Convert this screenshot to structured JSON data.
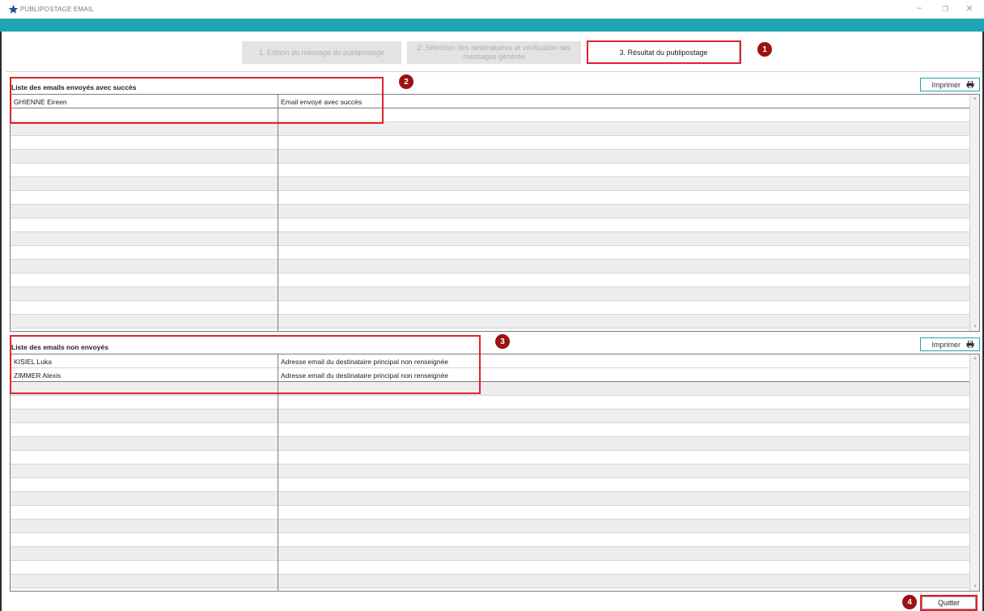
{
  "window": {
    "title": "PUBLIPOSTAGE EMAIL",
    "accent_color": "#1ea5b2",
    "controls": {
      "minimize": "–",
      "restore": "❐",
      "close": "✕"
    }
  },
  "steps": [
    {
      "label": "1. Edition du message du publipostage",
      "state": "disabled"
    },
    {
      "label": "2. Sélection des destinataires et vérification des messages générés",
      "state": "disabled"
    },
    {
      "label": "3. Résultat du publipostage",
      "state": "active"
    }
  ],
  "annotations": [
    "1",
    "2",
    "3",
    "4"
  ],
  "sent": {
    "title": "Liste des emails envoyés avec succès",
    "print_label": "Imprimer",
    "rows": [
      {
        "name": "GHIENNE Eireen",
        "status": "Email envoyé avec succès"
      }
    ]
  },
  "unsent": {
    "title": "Liste des emails non envoyés",
    "print_label": "Imprimer",
    "rows": [
      {
        "name": "KISIEL Luka",
        "status": "Adresse email du destinataire principal non renseignée"
      },
      {
        "name": "ZIMMER Alexis",
        "status": "Adresse email du destinataire principal non renseignée"
      }
    ]
  },
  "quit_label": "Quitter"
}
